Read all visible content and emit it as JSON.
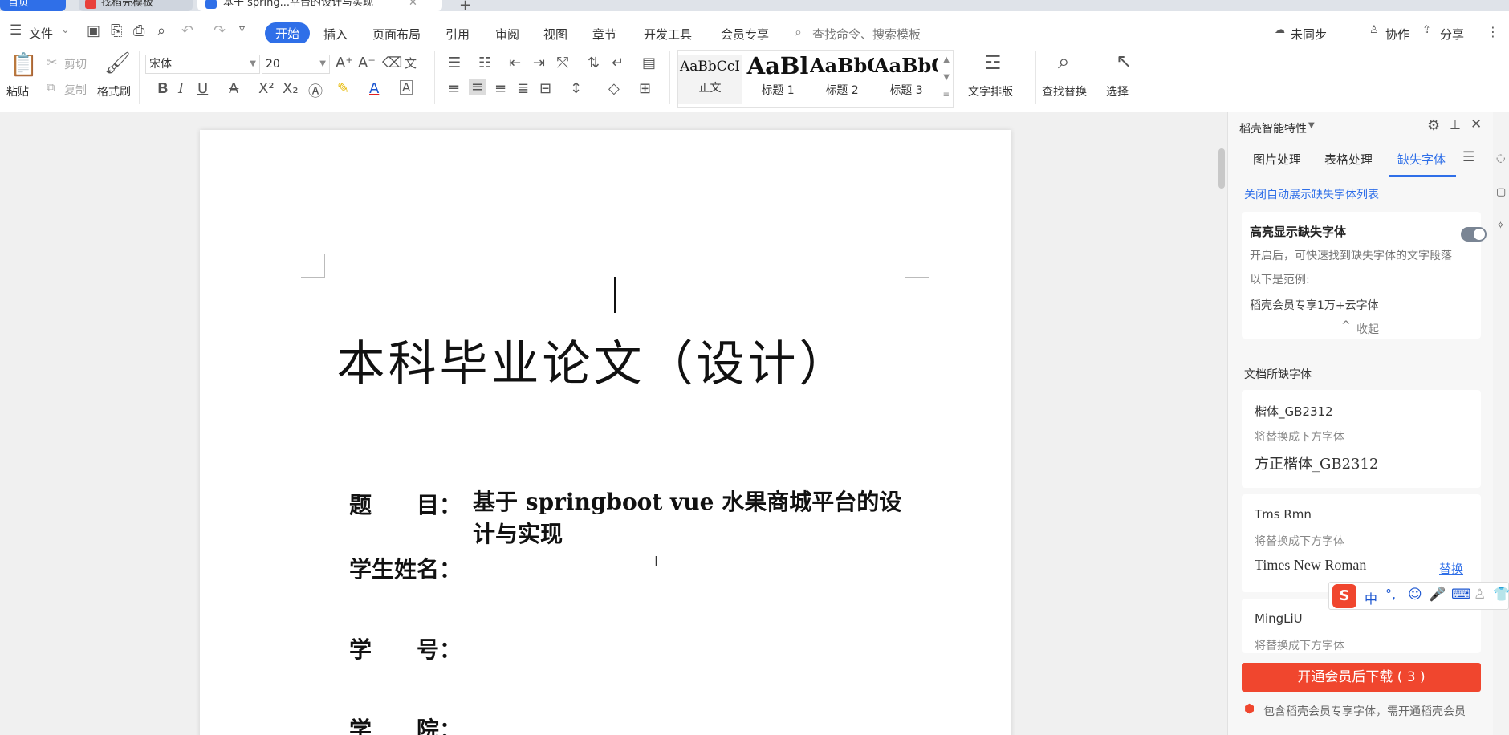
{
  "tabs": {
    "home": "首页",
    "template": "找稻壳模板",
    "doc": "基于 spring...平台的设计与实现",
    "new": "+"
  },
  "menu": {
    "file": "文件",
    "tabs": [
      "开始",
      "插入",
      "页面布局",
      "引用",
      "审阅",
      "视图",
      "章节",
      "开发工具",
      "会员专享"
    ],
    "search_placeholder": "查找命令、搜索模板",
    "sync": "未同步",
    "collab": "协作",
    "share": "分享"
  },
  "ribbon": {
    "paste": "粘贴",
    "cut": "剪切",
    "copy": "复制",
    "format_painter": "格式刷",
    "font_name": "宋体",
    "font_size": "20",
    "styles": [
      {
        "preview": "AaBbCcI",
        "name": "正文"
      },
      {
        "preview": "AaBl",
        "name": "标题 1"
      },
      {
        "preview": "AaBbC",
        "name": "标题 2"
      },
      {
        "preview": "AaBbC",
        "name": "标题 3"
      }
    ],
    "text_layout": "文字排版",
    "find_replace": "查找替换",
    "select": "选择"
  },
  "document": {
    "title": "本科毕业论文（设计）",
    "fields": [
      {
        "label": "题　　目：",
        "value": "基于 springboot vue 水果商城平台的设计与实现"
      },
      {
        "label": "学生姓名：",
        "value": ""
      },
      {
        "label": "学　　号：",
        "value": ""
      },
      {
        "label": "学　　院：",
        "value": ""
      }
    ]
  },
  "panel": {
    "header": "稻壳智能特性",
    "tabs": [
      "图片处理",
      "表格处理",
      "缺失字体"
    ],
    "active_tab": "缺失字体",
    "close_auto": "关闭自动展示缺失字体列表",
    "highlight_title": "高亮显示缺失字体",
    "highlight_desc": "开启后，可快速找到缺失字体的文字段落",
    "example_label": "以下是范例:",
    "example_text": "稻壳会员专享1万+云字体",
    "collapse": "收起",
    "missing_header": "文档所缺字体",
    "missing_fonts": [
      {
        "name": "楷体_GB2312",
        "hint": "将替换成下方字体",
        "replacement": "方正楷体_GB2312",
        "action": ""
      },
      {
        "name": "Tms Rmn",
        "hint": "将替换成下方字体",
        "replacement": "Times New Roman",
        "action": "替换"
      },
      {
        "name": "MingLiU",
        "hint": "将替换成下方字体",
        "replacement": "",
        "action": ""
      }
    ],
    "download_button": "开通会员后下载 ( 3 )",
    "footer_note": "包含稻壳会员专享字体，需开通稻壳会员"
  },
  "ime": {
    "mode": "中"
  },
  "colors": {
    "accent": "#2f6fe8",
    "download": "#f0462e"
  }
}
